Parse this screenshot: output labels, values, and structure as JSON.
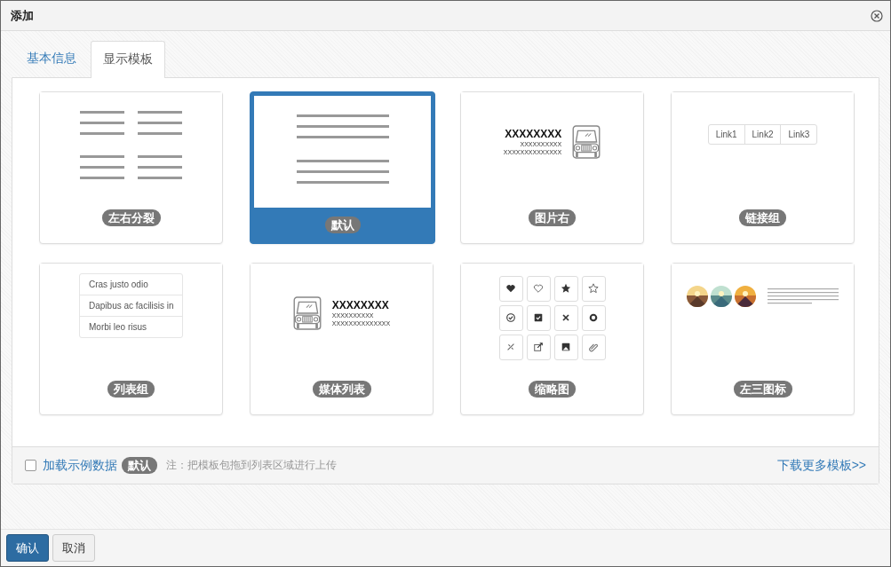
{
  "window": {
    "title": "添加"
  },
  "tabs": [
    {
      "label": "基本信息",
      "selected": false
    },
    {
      "label": "显示模板",
      "selected": true
    }
  ],
  "templates": [
    {
      "kind": "split",
      "label": "左右分裂",
      "selected": false
    },
    {
      "kind": "default",
      "label": "默认",
      "selected": true
    },
    {
      "kind": "media-right",
      "label": "图片右",
      "selected": false,
      "heading": "XXXXXXXX",
      "lines": [
        "XXXXXXXXXX",
        "XXXXXXXXXXXXXX"
      ]
    },
    {
      "kind": "links",
      "label": "链接组",
      "selected": false,
      "links": [
        "Link1",
        "Link2",
        "Link3"
      ]
    },
    {
      "kind": "list",
      "label": "列表组",
      "selected": false,
      "items": [
        "Cras justo odio",
        "Dapibus ac facilisis in",
        "Morbi leo risus"
      ]
    },
    {
      "kind": "media-left",
      "label": "媒体列表",
      "selected": false,
      "heading": "XXXXXXXX",
      "lines": [
        "XXXXXXXXXX",
        "XXXXXXXXXXXXXX"
      ]
    },
    {
      "kind": "thumbnails",
      "label": "缩略图",
      "selected": false
    },
    {
      "kind": "left-icons",
      "label": "左三图标",
      "selected": false
    }
  ],
  "footer": {
    "sample_data": {
      "label": "加载示例数据",
      "checked": false
    },
    "badge": "默认",
    "note": "注：把模板包拖到列表区域进行上传",
    "link": "下载更多模板>>"
  },
  "buttons": [
    {
      "label": "确认",
      "kind": "primary"
    },
    {
      "label": "取消",
      "kind": "default"
    }
  ]
}
